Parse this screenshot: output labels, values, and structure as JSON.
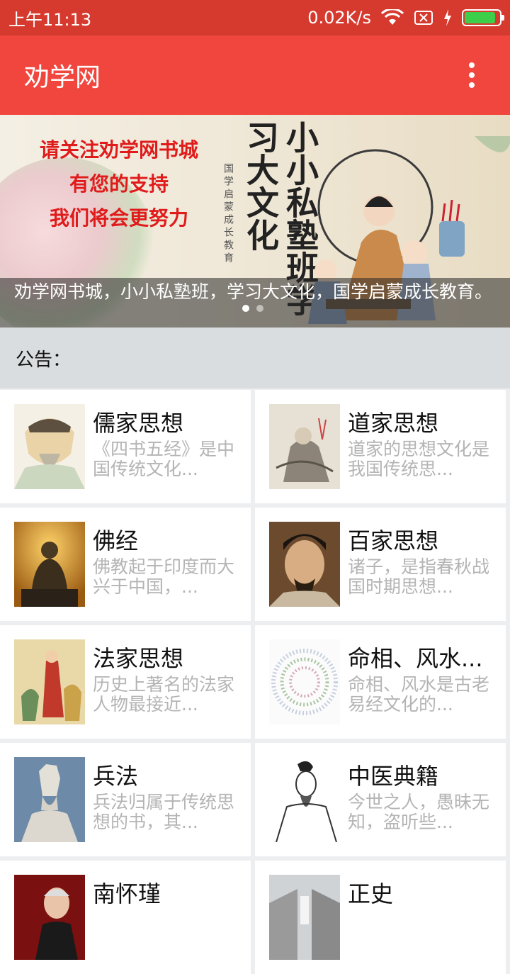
{
  "status_bar": {
    "time": "上午11:13",
    "speed": "0.02K/s",
    "battery_level": 0.9
  },
  "app_bar": {
    "title": "劝学网"
  },
  "banner": {
    "promo_lines": [
      "请关注劝学网书城",
      "有您的支持",
      "我们将会更努力"
    ],
    "vertical_text": "国学启蒙成长教育",
    "calligraphy": "小小私塾班学习大文化",
    "caption": "劝学网书城，小小私塾班，学习大文化，国学启蒙成长教育。",
    "page_index": 0,
    "page_count": 2
  },
  "notice": {
    "label": "公告："
  },
  "categories": [
    {
      "title": "儒家思想",
      "desc": "《四书五经》是中国传统文化...",
      "icon": "confucius-portrait"
    },
    {
      "title": "道家思想",
      "desc": "道家的思想文化是我国传统思...",
      "icon": "taoist-painting"
    },
    {
      "title": "佛经",
      "desc": "佛教起于印度而大兴于中国，...",
      "icon": "buddha-statue"
    },
    {
      "title": "百家思想",
      "desc": "诸子，是指春秋战国时期思想...",
      "icon": "scholar-portrait"
    },
    {
      "title": "法家思想",
      "desc": "历史上著名的法家人物最接近...",
      "icon": "legalist-painting"
    },
    {
      "title": "命相、风水...",
      "desc": "命相、风水是古老易经文化的...",
      "icon": "bagua-diagram"
    },
    {
      "title": "兵法",
      "desc": "兵法归属于传统思想的书，其...",
      "icon": "sunzi-statue"
    },
    {
      "title": "中医典籍",
      "desc": "今世之人，愚昧无知，盗听些...",
      "icon": "physician-sketch"
    },
    {
      "title": "南怀瑾",
      "desc": "",
      "icon": "portrait-photo"
    },
    {
      "title": "正史",
      "desc": "",
      "icon": "palace-photo"
    }
  ],
  "colors": {
    "status_bar": "#d63a2f",
    "app_bar": "#f1463d",
    "notice_bg": "#d9dde0",
    "desc_text": "#b4b4b4"
  }
}
